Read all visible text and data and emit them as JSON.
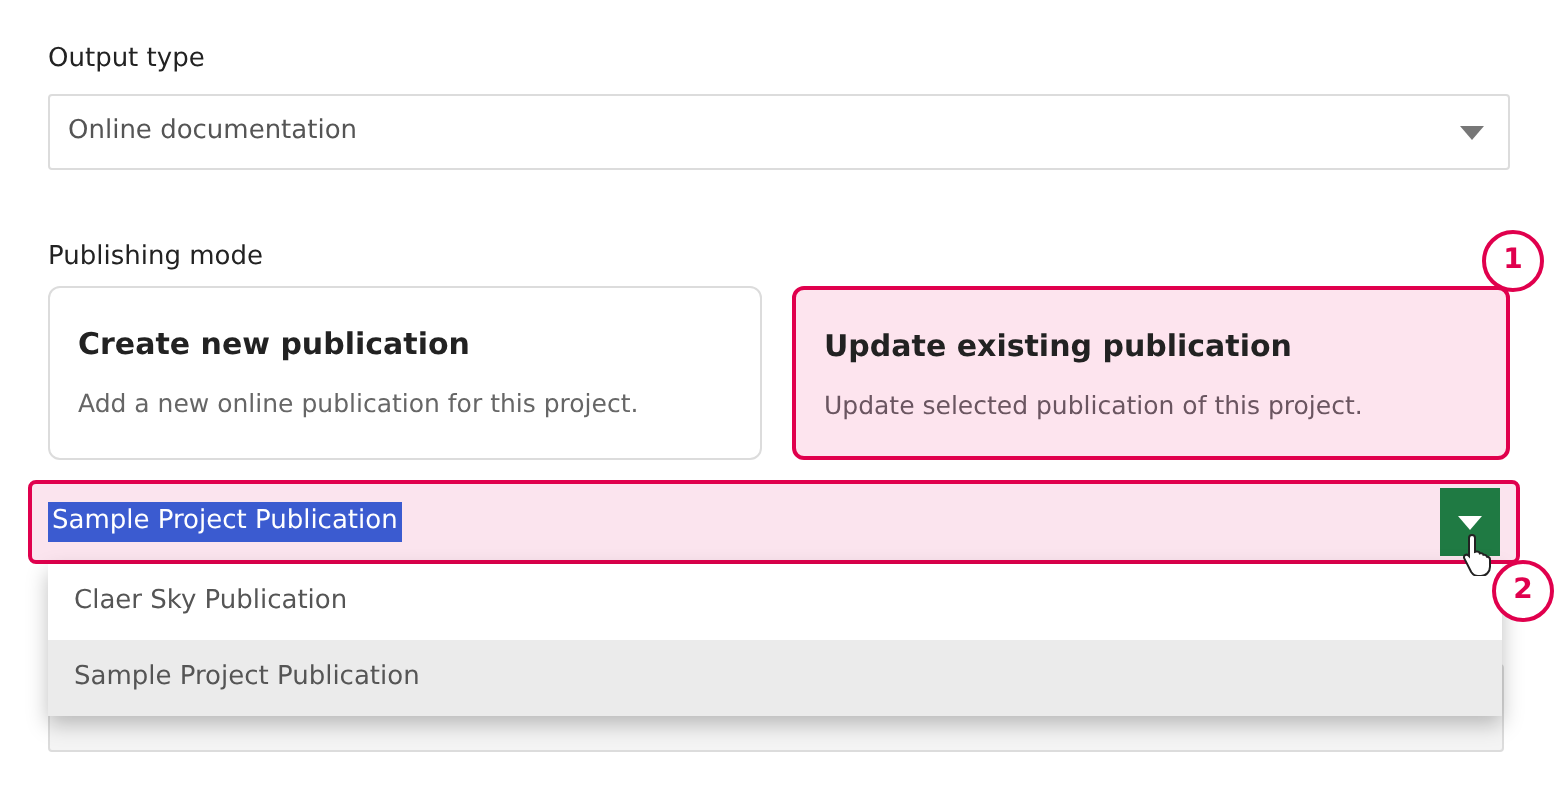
{
  "output_type": {
    "label": "Output type",
    "value": "Online documentation"
  },
  "publishing_mode": {
    "label": "Publishing mode",
    "options": [
      {
        "title": "Create new publication",
        "description": "Add a new online publication for this project.",
        "selected": false
      },
      {
        "title": "Update existing publication",
        "description": "Update selected publication of this project.",
        "selected": true
      }
    ]
  },
  "publication_select": {
    "value": "Sample Project Publication",
    "expanded": true,
    "options": [
      {
        "label": "Claer Sky Publication",
        "selected": false
      },
      {
        "label": "Sample Project Publication",
        "selected": true
      }
    ]
  },
  "callouts": [
    "1",
    "2"
  ]
}
